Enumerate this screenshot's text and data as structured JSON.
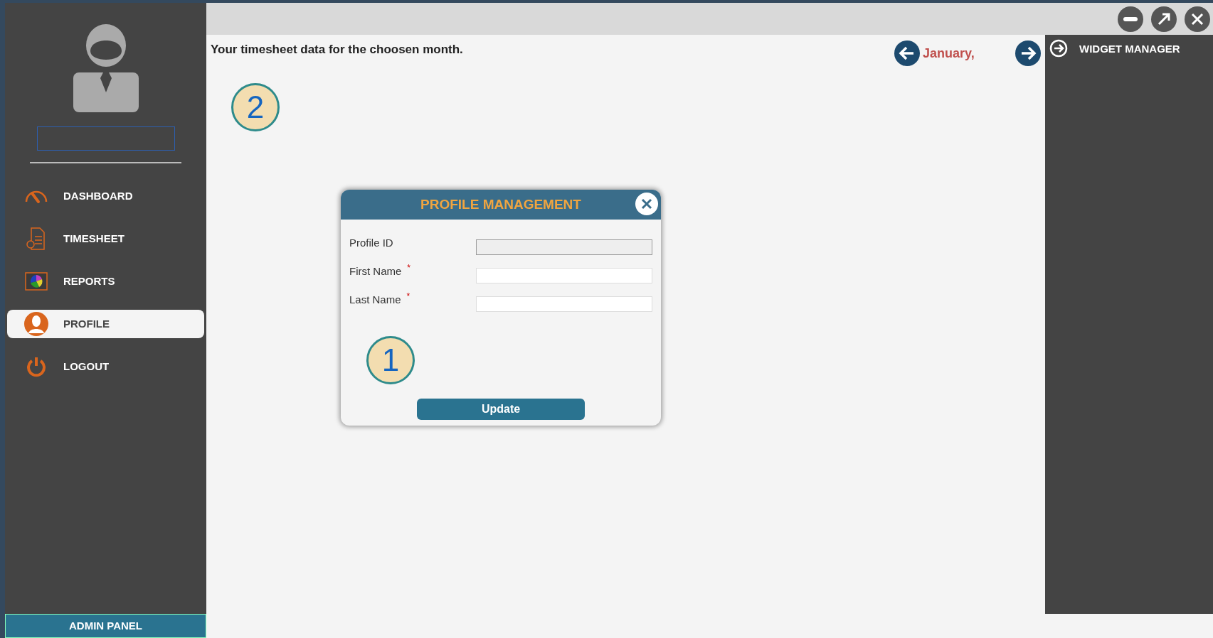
{
  "sidebar": {
    "items": [
      {
        "label": "DASHBOARD",
        "kind": "gauge",
        "selected": false
      },
      {
        "label": "TIMESHEET",
        "kind": "sheet",
        "selected": false
      },
      {
        "label": "REPORTS",
        "kind": "chart",
        "selected": false
      },
      {
        "label": "PROFILE",
        "kind": "person",
        "selected": true
      },
      {
        "label": "LOGOUT",
        "kind": "power",
        "selected": false
      }
    ],
    "footer_button": "ADMIN PANEL"
  },
  "main": {
    "heading": "Your timesheet data for the choosen month.",
    "month": "January,",
    "callout": "2"
  },
  "widget_manager": {
    "title": "WIDGET MANAGER"
  },
  "dialog": {
    "title": "PROFILE MANAGEMENT",
    "fields": [
      {
        "label": "Profile ID",
        "disabled": true
      },
      {
        "label": "First Name",
        "required_mark": "*",
        "disabled": false
      },
      {
        "label": "Last Name",
        "required_mark": "*",
        "disabled": false
      }
    ],
    "callout": "1",
    "button": "Update"
  }
}
